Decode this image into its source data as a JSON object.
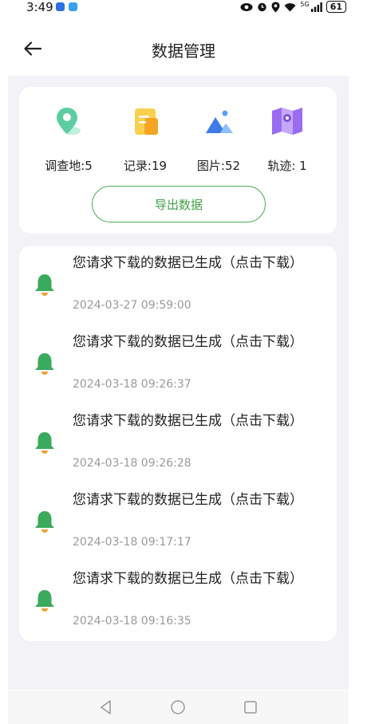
{
  "status_bar": {
    "time": "3:49",
    "network": "5G",
    "battery": "61"
  },
  "header": {
    "title": "数据管理"
  },
  "stats": [
    {
      "label": "调查地:5",
      "icon": "location-pin-icon",
      "color": "#5ccda0"
    },
    {
      "label": "记录:19",
      "icon": "document-icon",
      "color": "#f6c343"
    },
    {
      "label": "图片:52",
      "icon": "image-icon",
      "color": "#3d7be8"
    },
    {
      "label": "轨迹: 1",
      "icon": "map-icon",
      "color": "#9b6cf0"
    }
  ],
  "export_button": {
    "label": "导出数据"
  },
  "messages": [
    {
      "title": "您请求下载的数据已生成（点击下载）",
      "time": "2024-03-27 09:59:00"
    },
    {
      "title": "您请求下载的数据已生成（点击下载）",
      "time": "2024-03-18 09:26:37"
    },
    {
      "title": "您请求下载的数据已生成（点击下载）",
      "time": "2024-03-18 09:26:28"
    },
    {
      "title": "您请求下载的数据已生成（点击下载）",
      "time": "2024-03-18 09:17:17"
    },
    {
      "title": "您请求下载的数据已生成（点击下载）",
      "time": "2024-03-18 09:16:35"
    }
  ],
  "colors": {
    "accent": "#4caf50",
    "background": "#f2f2f7",
    "bell": "#3aaa5c",
    "bell_clapper": "#f0a030"
  }
}
